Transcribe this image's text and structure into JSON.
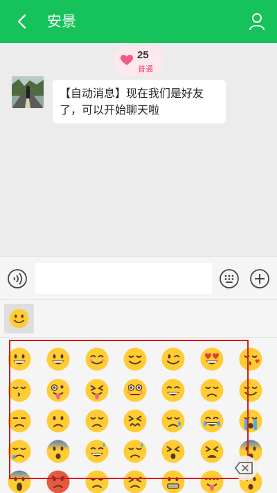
{
  "header": {
    "title": "安景",
    "back_icon": "back-arrow-icon",
    "profile_icon": "person-icon",
    "color": "#16c25a"
  },
  "intimacy": {
    "count": "25",
    "level": "普通",
    "icon": "heart-icon"
  },
  "messages": [
    {
      "sender": "contact",
      "text_line1": "【自动消息】现在我们是好友",
      "text_line2": "了，可以开始聊天啦"
    }
  ],
  "input_bar": {
    "value": "",
    "voice_icon": "voice-icon",
    "keyboard_icon": "keyboard-icon",
    "plus_icon": "plus-icon"
  },
  "emoji_panel": {
    "selected_tab_icon": "smiley-emoji-tab",
    "rows": [
      [
        "grinning-big-eyes",
        "grinning",
        "smiling-blush",
        "relaxed",
        "winking",
        "heart-eyes",
        "kissing-heart"
      ],
      [
        "kissing-closed-eyes",
        "zany-tongue",
        "squinting-tongue",
        "flushed",
        "beaming-grin",
        "pensive",
        "relieved"
      ],
      [
        "unamused",
        "worried",
        "disappointed",
        "confounded",
        "crying-tear",
        "tears-of-joy",
        "loudly-crying"
      ],
      [
        "sleepy",
        "anxious-sweat",
        "grinning-sweat",
        "downcast-sweat",
        "tired",
        "weary",
        "fearful"
      ],
      [
        "screaming",
        "angry",
        "triumph",
        "persevering",
        "grimacing",
        "yum",
        "astonished"
      ]
    ],
    "delete_icon": "backspace-icon"
  }
}
